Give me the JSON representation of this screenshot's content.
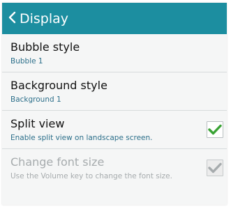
{
  "header": {
    "title": "Display",
    "back_icon": "chevron-left-icon",
    "color": "#1c8ea0"
  },
  "settings": [
    {
      "title": "Bubble style",
      "subtitle": "Bubble 1"
    },
    {
      "title": "Background style",
      "subtitle": "Background 1"
    },
    {
      "title": "Split view",
      "subtitle": "Enable split view on landscape screen.",
      "checked": true,
      "check_color": "#3aa335"
    },
    {
      "title": "Change font size",
      "subtitle": "Use the Volume key to change the font size.",
      "checked": true,
      "disabled": true,
      "check_color": "#a6abad"
    }
  ]
}
